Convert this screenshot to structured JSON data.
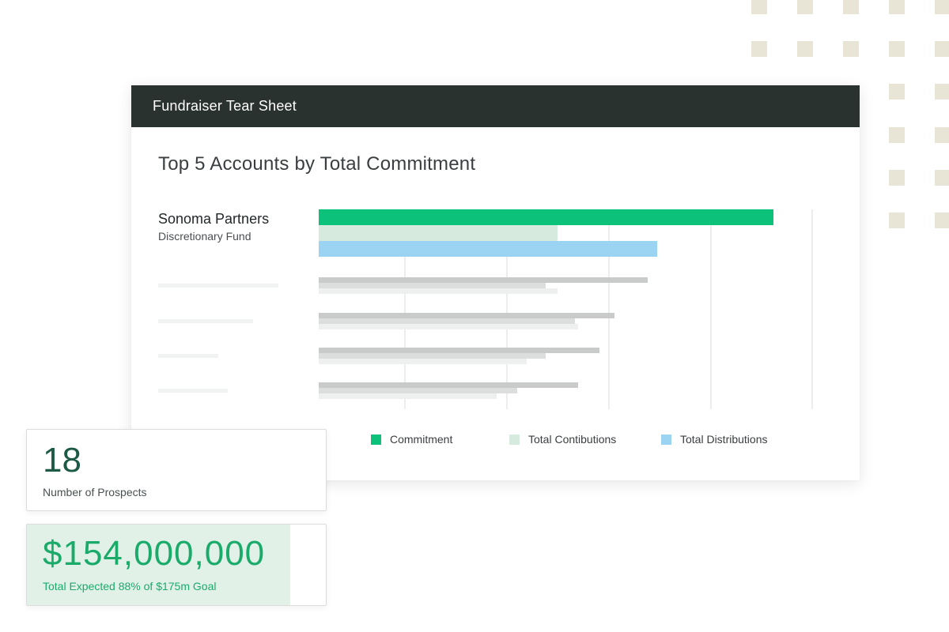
{
  "header": {
    "title": "Fundraiser Tear Sheet"
  },
  "chart_data": {
    "type": "bar",
    "title": "Top 5 Accounts by Total Commitment",
    "highlighted_account": {
      "name": "Sonoma Partners",
      "subtitle": "Discretionary Fund"
    },
    "series": [
      {
        "name": "Commitment",
        "color": "#0cc27a",
        "values": [
          0.92,
          0.665,
          0.598,
          0.568,
          0.525
        ]
      },
      {
        "name": "Total Contibutions",
        "color": "#d6ebdd",
        "values": [
          0.483,
          0.459,
          0.518,
          0.459,
          0.401
        ]
      },
      {
        "name": "Total Distributions",
        "color": "#9ad4f2",
        "values": [
          0.684,
          0.483,
          0.525,
          0.42,
          0.36
        ]
      }
    ],
    "grid": true
  },
  "legend": {
    "items": [
      {
        "label": "Commitment",
        "color": "#0cc27a"
      },
      {
        "label": "Total Contibutions",
        "color": "#d6ebdd"
      },
      {
        "label": "Total Distributions",
        "color": "#9ad4f2"
      }
    ]
  },
  "stats": {
    "prospects": {
      "value": "18",
      "label": "Number of Prospects"
    },
    "expected": {
      "value": "$154,000,000",
      "label": "Total Expected 88% of $175m Goal",
      "progress_percent": 88
    }
  },
  "colors": {
    "header_bg": "#29322f",
    "accent_green": "#1aab6b",
    "dark_green": "#1d5a45",
    "decor_dot": "#e8e4d6",
    "muted_bar": "#c8caca"
  }
}
